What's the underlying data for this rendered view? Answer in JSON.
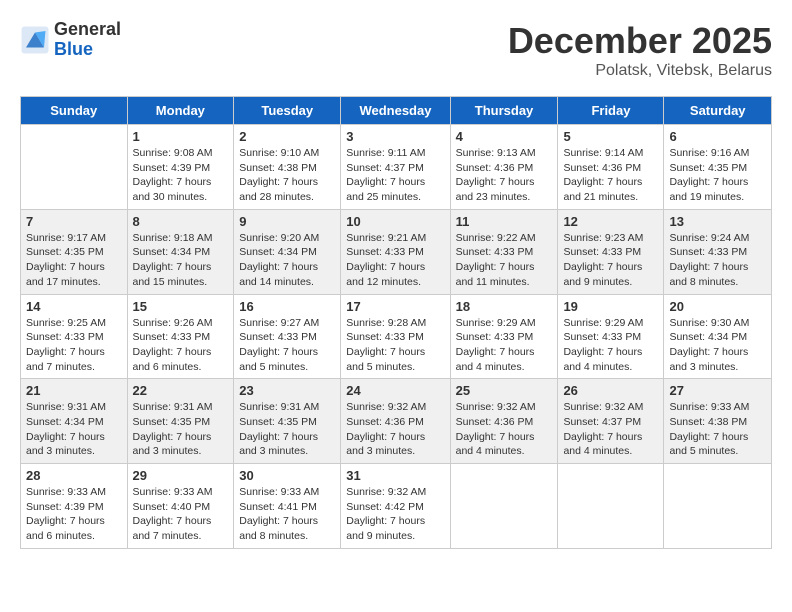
{
  "logo": {
    "general": "General",
    "blue": "Blue"
  },
  "title": "December 2025",
  "location": "Polatsk, Vitebsk, Belarus",
  "days_of_week": [
    "Sunday",
    "Monday",
    "Tuesday",
    "Wednesday",
    "Thursday",
    "Friday",
    "Saturday"
  ],
  "weeks": [
    [
      {
        "day": "",
        "info": ""
      },
      {
        "day": "1",
        "info": "Sunrise: 9:08 AM\nSunset: 4:39 PM\nDaylight: 7 hours\nand 30 minutes."
      },
      {
        "day": "2",
        "info": "Sunrise: 9:10 AM\nSunset: 4:38 PM\nDaylight: 7 hours\nand 28 minutes."
      },
      {
        "day": "3",
        "info": "Sunrise: 9:11 AM\nSunset: 4:37 PM\nDaylight: 7 hours\nand 25 minutes."
      },
      {
        "day": "4",
        "info": "Sunrise: 9:13 AM\nSunset: 4:36 PM\nDaylight: 7 hours\nand 23 minutes."
      },
      {
        "day": "5",
        "info": "Sunrise: 9:14 AM\nSunset: 4:36 PM\nDaylight: 7 hours\nand 21 minutes."
      },
      {
        "day": "6",
        "info": "Sunrise: 9:16 AM\nSunset: 4:35 PM\nDaylight: 7 hours\nand 19 minutes."
      }
    ],
    [
      {
        "day": "7",
        "info": "Sunrise: 9:17 AM\nSunset: 4:35 PM\nDaylight: 7 hours\nand 17 minutes."
      },
      {
        "day": "8",
        "info": "Sunrise: 9:18 AM\nSunset: 4:34 PM\nDaylight: 7 hours\nand 15 minutes."
      },
      {
        "day": "9",
        "info": "Sunrise: 9:20 AM\nSunset: 4:34 PM\nDaylight: 7 hours\nand 14 minutes."
      },
      {
        "day": "10",
        "info": "Sunrise: 9:21 AM\nSunset: 4:33 PM\nDaylight: 7 hours\nand 12 minutes."
      },
      {
        "day": "11",
        "info": "Sunrise: 9:22 AM\nSunset: 4:33 PM\nDaylight: 7 hours\nand 11 minutes."
      },
      {
        "day": "12",
        "info": "Sunrise: 9:23 AM\nSunset: 4:33 PM\nDaylight: 7 hours\nand 9 minutes."
      },
      {
        "day": "13",
        "info": "Sunrise: 9:24 AM\nSunset: 4:33 PM\nDaylight: 7 hours\nand 8 minutes."
      }
    ],
    [
      {
        "day": "14",
        "info": "Sunrise: 9:25 AM\nSunset: 4:33 PM\nDaylight: 7 hours\nand 7 minutes."
      },
      {
        "day": "15",
        "info": "Sunrise: 9:26 AM\nSunset: 4:33 PM\nDaylight: 7 hours\nand 6 minutes."
      },
      {
        "day": "16",
        "info": "Sunrise: 9:27 AM\nSunset: 4:33 PM\nDaylight: 7 hours\nand 5 minutes."
      },
      {
        "day": "17",
        "info": "Sunrise: 9:28 AM\nSunset: 4:33 PM\nDaylight: 7 hours\nand 5 minutes."
      },
      {
        "day": "18",
        "info": "Sunrise: 9:29 AM\nSunset: 4:33 PM\nDaylight: 7 hours\nand 4 minutes."
      },
      {
        "day": "19",
        "info": "Sunrise: 9:29 AM\nSunset: 4:33 PM\nDaylight: 7 hours\nand 4 minutes."
      },
      {
        "day": "20",
        "info": "Sunrise: 9:30 AM\nSunset: 4:34 PM\nDaylight: 7 hours\nand 3 minutes."
      }
    ],
    [
      {
        "day": "21",
        "info": "Sunrise: 9:31 AM\nSunset: 4:34 PM\nDaylight: 7 hours\nand 3 minutes."
      },
      {
        "day": "22",
        "info": "Sunrise: 9:31 AM\nSunset: 4:35 PM\nDaylight: 7 hours\nand 3 minutes."
      },
      {
        "day": "23",
        "info": "Sunrise: 9:31 AM\nSunset: 4:35 PM\nDaylight: 7 hours\nand 3 minutes."
      },
      {
        "day": "24",
        "info": "Sunrise: 9:32 AM\nSunset: 4:36 PM\nDaylight: 7 hours\nand 3 minutes."
      },
      {
        "day": "25",
        "info": "Sunrise: 9:32 AM\nSunset: 4:36 PM\nDaylight: 7 hours\nand 4 minutes."
      },
      {
        "day": "26",
        "info": "Sunrise: 9:32 AM\nSunset: 4:37 PM\nDaylight: 7 hours\nand 4 minutes."
      },
      {
        "day": "27",
        "info": "Sunrise: 9:33 AM\nSunset: 4:38 PM\nDaylight: 7 hours\nand 5 minutes."
      }
    ],
    [
      {
        "day": "28",
        "info": "Sunrise: 9:33 AM\nSunset: 4:39 PM\nDaylight: 7 hours\nand 6 minutes."
      },
      {
        "day": "29",
        "info": "Sunrise: 9:33 AM\nSunset: 4:40 PM\nDaylight: 7 hours\nand 7 minutes."
      },
      {
        "day": "30",
        "info": "Sunrise: 9:33 AM\nSunset: 4:41 PM\nDaylight: 7 hours\nand 8 minutes."
      },
      {
        "day": "31",
        "info": "Sunrise: 9:32 AM\nSunset: 4:42 PM\nDaylight: 7 hours\nand 9 minutes."
      },
      {
        "day": "",
        "info": ""
      },
      {
        "day": "",
        "info": ""
      },
      {
        "day": "",
        "info": ""
      }
    ]
  ]
}
